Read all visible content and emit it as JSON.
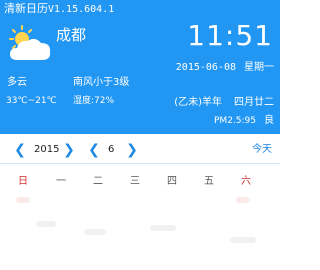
{
  "app": {
    "title": "清新日历",
    "version": "V1.15.604.1"
  },
  "weather": {
    "city": "成都",
    "condition": "多云",
    "temperature": "33℃~21℃",
    "wind": "南风小于3级",
    "humidity": "湿度:72%",
    "icon": "partly-cloudy-icon"
  },
  "clock": {
    "time": "11:51"
  },
  "date": {
    "solar": "2015-06-08",
    "weekday": "星期一"
  },
  "lunar": {
    "ganzhi": "(乙未)羊年",
    "day": "四月廿二"
  },
  "air": {
    "pm": "PM2.5:95",
    "quality": "良"
  },
  "nav": {
    "year": "2015",
    "month": "6",
    "today_label": "今天"
  },
  "weekdays": [
    "日",
    "一",
    "二",
    "三",
    "四",
    "五",
    "六"
  ],
  "colors": {
    "header_bg": "#2196f3",
    "accent": "#1e88e5",
    "weekend": "#d32f2f"
  }
}
